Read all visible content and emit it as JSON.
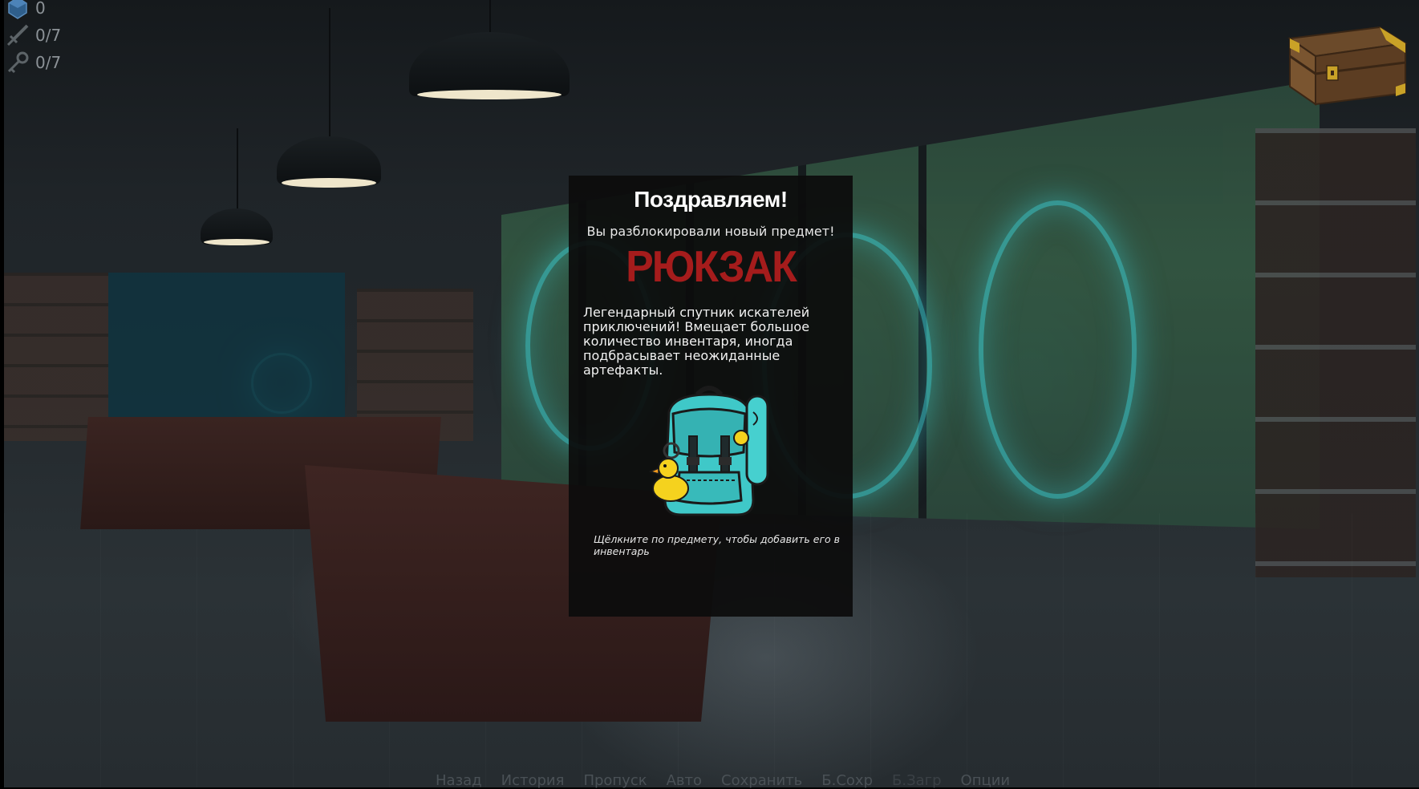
{
  "hud": {
    "gems": {
      "icon": "gem-icon",
      "value": "0"
    },
    "swords": {
      "icon": "sword-icon",
      "value": "0/7"
    },
    "keys": {
      "icon": "key-icon",
      "value": "0/7"
    }
  },
  "inventory": {
    "icon": "treasure-chest-icon"
  },
  "popup": {
    "title": "Поздравляем!",
    "subtitle": "Вы разблокировали новый предмет!",
    "item_name": "РЮКЗАК",
    "description": "Легендарный спутник искателей приключений! Вмещает большое количество инвентаря, иногда подбрасывает неожиданные артефакты.",
    "item_icon": "backpack-icon",
    "hint": "Щёлкните по предмету, чтобы добавить его в инвентарь"
  },
  "quick_menu": {
    "back": "Назад",
    "history": "История",
    "skip": "Пропуск",
    "auto": "Авто",
    "save": "Сохранить",
    "quick_save": "Б.Сохр",
    "quick_load": "Б.Загр",
    "options": "Опции"
  },
  "colors": {
    "item_name": "#a51c1c",
    "popup_bg": "#0c0c0c",
    "backpack": "#3fc8c8",
    "duck": "#f5d21e"
  }
}
